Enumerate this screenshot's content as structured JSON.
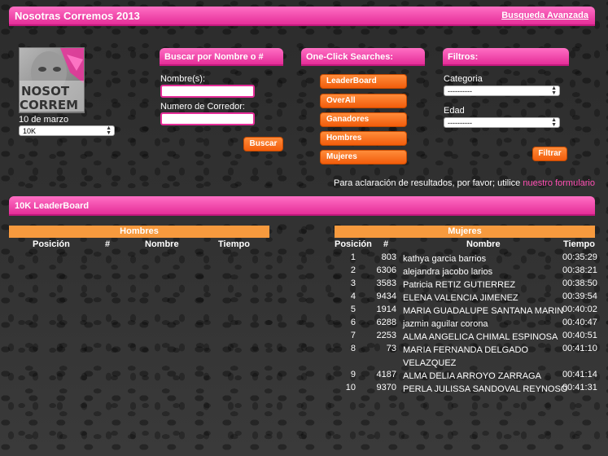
{
  "header": {
    "title": "Nosotras Corremos 2013",
    "advanced_search": "Busqueda Avanzada"
  },
  "event": {
    "date": "10 de marzo",
    "distance_selected": "10K",
    "logo_text_line1": "NOSOT",
    "logo_text_line2": "CORREM"
  },
  "search_panel": {
    "title": "Buscar por Nombre o #",
    "name_label": "Nombre(s):",
    "runner_number_label": "Numero de Corredor:",
    "submit_label": "Buscar"
  },
  "oneclick_panel": {
    "title": "One-Click Searches:",
    "buttons": [
      "LeaderBoard",
      "OverAll",
      "Ganadores",
      "Hombres",
      "Mujeres"
    ]
  },
  "filters_panel": {
    "title": "Filtros:",
    "category_label": "Categoria",
    "category_value": "----------",
    "age_label": "Edad",
    "age_value": "----------",
    "submit_label": "Filtrar"
  },
  "clarification": {
    "text": "Para aclaración de resultados, por favor; utilice ",
    "link": "nuestro formulario"
  },
  "leaderboard": {
    "title": "10K LeaderBoard",
    "men": {
      "heading": "Hombres",
      "columns": [
        "Posición",
        "#",
        "Nombre",
        "Tiempo"
      ]
    },
    "women": {
      "heading": "Mujeres",
      "columns": [
        "Posición",
        "#",
        "Nombre",
        "Tiempo"
      ],
      "rows": [
        {
          "pos": "1",
          "num": "803",
          "name": "kathya garcia barrios",
          "time": "00:35:29"
        },
        {
          "pos": "2",
          "num": "6306",
          "name": "alejandra jacobo larios",
          "time": "00:38:21"
        },
        {
          "pos": "3",
          "num": "3583",
          "name": "Patricia RETIZ GUTIERREZ",
          "time": "00:38:50"
        },
        {
          "pos": "4",
          "num": "9434",
          "name": "ELENA VALENCIA JIMENEZ",
          "time": "00:39:54"
        },
        {
          "pos": "5",
          "num": "1914",
          "name": "MARIA GUADALUPE SANTANA MARIN",
          "time": "00:40:02"
        },
        {
          "pos": "6",
          "num": "6288",
          "name": "jazmin aguilar corona",
          "time": "00:40:47"
        },
        {
          "pos": "7",
          "num": "2253",
          "name": "ALMA ANGELICA CHIMAL ESPINOSA",
          "time": "00:40:51"
        },
        {
          "pos": "8",
          "num": "73",
          "name": "MARIA FERNANDA DELGADO VELAZQUEZ",
          "time": "00:41:10"
        },
        {
          "pos": "9",
          "num": "4187",
          "name": "ALMA DELIA ARROYO ZARRAGA",
          "time": "00:41:14"
        },
        {
          "pos": "10",
          "num": "9370",
          "name": "PERLA JULISSA SANDOVAL REYNOSO",
          "time": "00:41:31"
        }
      ]
    }
  }
}
